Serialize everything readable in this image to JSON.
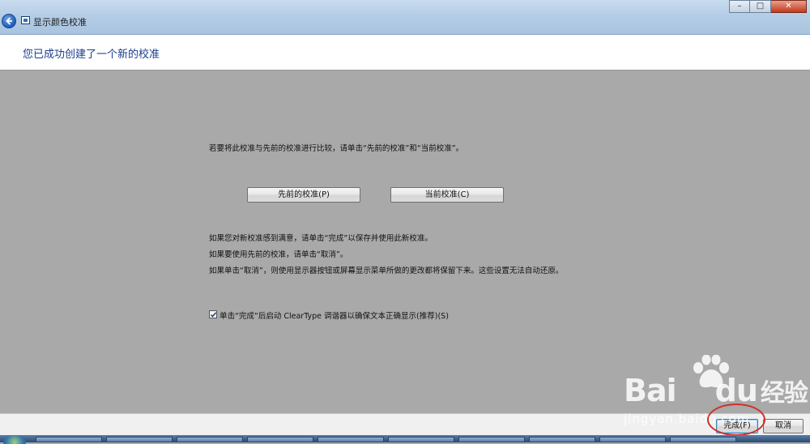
{
  "window": {
    "title": "显示颜色校准",
    "controls": [
      "minimize-icon",
      "maximize-icon",
      "close-icon"
    ]
  },
  "header": {
    "title": "您已成功创建了一个新的校准"
  },
  "main": {
    "compare_instruction": "若要将此校准与先前的校准进行比较，请单击“先前的校准”和“当前校准”。",
    "previous_button": "先前的校准(P)",
    "current_button": "当前校准(C)",
    "line_satisfied": "如果您对新校准感到满意，请单击“完成”以保存并使用此新校准。",
    "line_use_previous": "如果要使用先前的校准，请单击“取消”。",
    "line_cancel_warning": "如果单击“取消”，则使用显示器按钮或屏幕显示菜单所做的更改都将保留下来。这些设置无法自动还原。",
    "cleartype_checkbox": {
      "label": "单击“完成”后启动 ClearType 调谐器以确保文本正确显示(推荐)(S)",
      "checked": true
    }
  },
  "footer": {
    "finish_button": "完成(F)",
    "cancel_button": "取消"
  },
  "watermark": {
    "brand": "Bai",
    "brand_suffix": "du",
    "cn": "经验",
    "url": "jingyan.baidu.com"
  },
  "colors": {
    "title_blue": "#1a3e8c",
    "content_bg": "#a9a9a9",
    "highlight_ring": "#d0302a"
  }
}
